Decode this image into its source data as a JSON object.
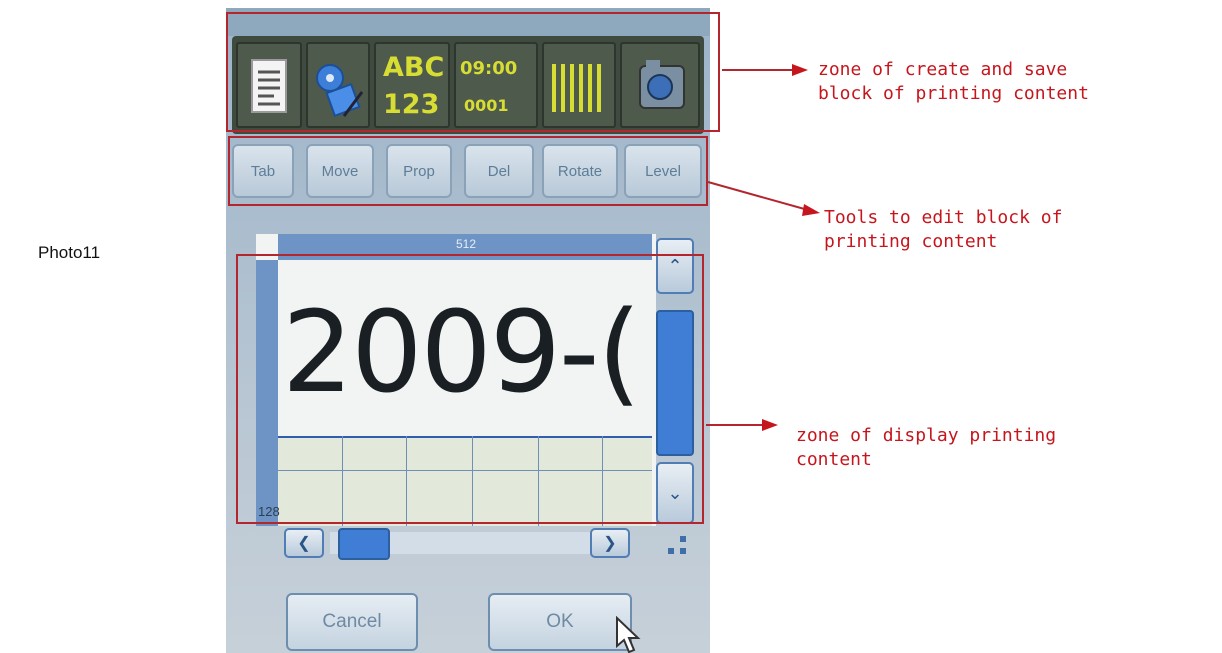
{
  "caption": "Photo11",
  "toolbar": {
    "text_icon_top": "ABC",
    "text_icon_bottom": "123",
    "time_icon_top": "09:00",
    "time_icon_bottom": "0001"
  },
  "edit_tools": [
    "Tab",
    "Move",
    "Prop",
    "Del",
    "Rotate",
    "Level"
  ],
  "canvas": {
    "ruler_top_value": "512",
    "ruler_left_value": "128",
    "content_text": "2009-("
  },
  "dialog": {
    "cancel_label": "Cancel",
    "ok_label": "OK"
  },
  "annotations": {
    "zone_create": "zone of create and save\nblock of printing content",
    "zone_tools": "Tools to edit block of\nprinting content",
    "zone_display": "zone of display printing\ncontent"
  },
  "colors": {
    "annotation_red": "#c6161d",
    "toolbar_icon_yellow": "#d8dd33",
    "scroll_blue": "#3f7ed4"
  },
  "icons": [
    "document-icon",
    "save-disk-icon",
    "barcode-icon",
    "camera-icon",
    "chevron-up-icon",
    "chevron-down-icon",
    "chevron-left-icon",
    "chevron-right-icon",
    "resize-grip-icon",
    "mouse-pointer-icon"
  ]
}
